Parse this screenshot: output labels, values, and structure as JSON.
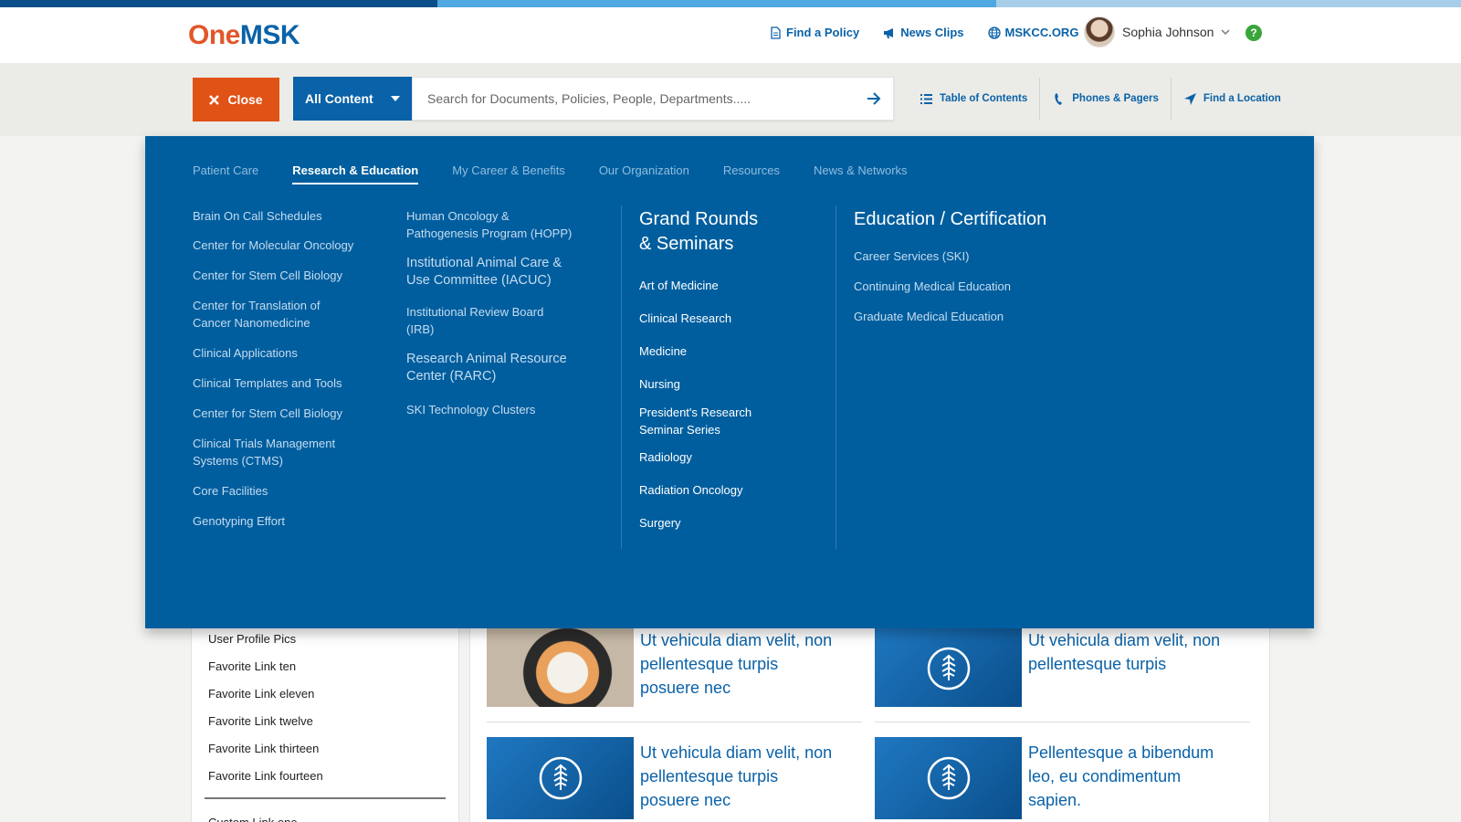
{
  "brand": {
    "one": "One",
    "msk": "MSK"
  },
  "header_links": [
    {
      "label": "Find a Policy",
      "icon": "document-icon"
    },
    {
      "label": "News Clips",
      "icon": "megaphone-icon"
    },
    {
      "label": "MSKCC.ORG",
      "icon": "globe-icon"
    }
  ],
  "user": {
    "name": "Sophia Johnson",
    "help": "?"
  },
  "search": {
    "close_label": "Close",
    "scope_label": "All Content",
    "placeholder": "Search for Documents, Policies, People, Departments....."
  },
  "tools": [
    {
      "label": "Table of Contents",
      "icon": "list-icon"
    },
    {
      "label": "Phones & Pagers",
      "icon": "phone-icon"
    },
    {
      "label": "Find a Location",
      "icon": "location-arrow-icon"
    }
  ],
  "menu": {
    "tabs": [
      "Patient Care",
      "Research & Education",
      "My Career & Benefits",
      "Our Organization",
      "Resources",
      "News & Networks"
    ],
    "active_tab": "Research & Education",
    "col1": [
      [
        "Brain On Call Schedules"
      ],
      [
        "Center for Molecular Oncology"
      ],
      [
        "Center for Stem Cell Biology"
      ],
      [
        "Center for Translation of",
        "Cancer Nanomedicine"
      ],
      [
        "Clinical Applications"
      ],
      [
        "Clinical Templates and Tools"
      ],
      [
        "Center for Stem Cell Biology"
      ],
      [
        "Clinical Trials Management",
        "Systems (CTMS)"
      ],
      [
        "Core Facilities"
      ],
      [
        "Genotyping Effort"
      ]
    ],
    "col2": [
      [
        "Human Oncology &",
        "Pathogenesis Program (HOPP)"
      ],
      [
        "Institutional Animal Care &",
        "Use Committee (IACUC)"
      ],
      [
        "Institutional Review Board",
        "(IRB)"
      ],
      [
        "Research Animal Resource",
        "Center (RARC)"
      ],
      [
        "SKI Technology Clusters"
      ]
    ],
    "col3_heading": [
      "Grand Rounds",
      "& Seminars"
    ],
    "col3": [
      [
        "Art of Medicine"
      ],
      [
        "Clinical Research"
      ],
      [
        "Medicine"
      ],
      [
        "Nursing"
      ],
      [
        "President's Research",
        "Seminar Series"
      ],
      [
        "Radiology"
      ],
      [
        "Radiation Oncology"
      ],
      [
        "Surgery"
      ]
    ],
    "col4_heading": "Education / Certification",
    "col4": [
      [
        "Career Services (SKI)"
      ],
      [
        "Continuing Medical Education"
      ],
      [
        "Graduate Medical Education"
      ]
    ]
  },
  "favorites": [
    "User Profile Pics",
    "Favorite Link ten",
    "Favorite Link eleven",
    "Favorite Link twelve",
    "Favorite Link thirteen",
    "Favorite Link fourteen"
  ],
  "custom_link": "Custom Link one",
  "news": [
    {
      "title": [
        "Ut vehicula diam velit, non",
        "pellentesque turpis",
        "posuere nec"
      ],
      "thumb": "photo"
    },
    {
      "title": [
        "Ut vehicula diam velit, non",
        "pellentesque turpis"
      ],
      "thumb": "logo"
    },
    {
      "title": [
        "Ut vehicula diam velit, non",
        "pellentesque turpis",
        "posuere nec"
      ],
      "thumb": "logo"
    },
    {
      "title": [
        "Pellentesque a bibendum",
        "leo, eu condimentum",
        "sapien."
      ],
      "thumb": "logo"
    }
  ],
  "colors": {
    "brand_orange": "#e2562a",
    "brand_blue": "#0a62a8",
    "menu_blue": "#005e9e",
    "close_orange": "#e05216"
  }
}
